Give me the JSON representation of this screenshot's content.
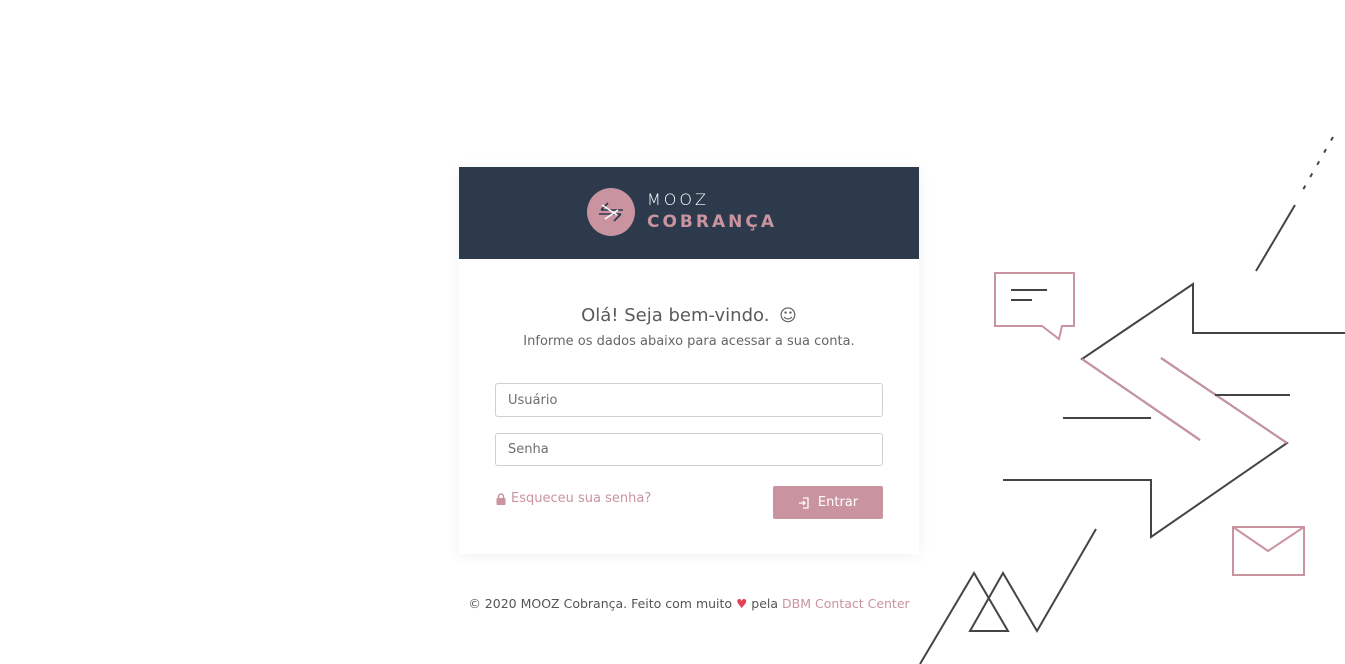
{
  "brand": {
    "line1": "MOOZ",
    "line2": "COBRANÇA",
    "header_color": "#2c3a4b",
    "accent_color": "#c9949f"
  },
  "login": {
    "title": "Olá! Seja bem-vindo.",
    "title_emoji": "☺",
    "subtitle": "Informe os dados abaixo para acessar a sua conta.",
    "username_placeholder": "Usuário",
    "password_placeholder": "Senha",
    "forgot_label": "Esqueceu sua senha?",
    "submit_label": "Entrar"
  },
  "footer": {
    "prefix": "© 2020 MOOZ Cobrança. Feito com muito",
    "heart": "♥",
    "middle": "pela",
    "link_label": "DBM Contact Center"
  },
  "icons": {
    "logo": "arrows-exchange-icon",
    "forgot": "lock-icon",
    "submit": "sign-in-icon",
    "heart": "heart-icon"
  }
}
